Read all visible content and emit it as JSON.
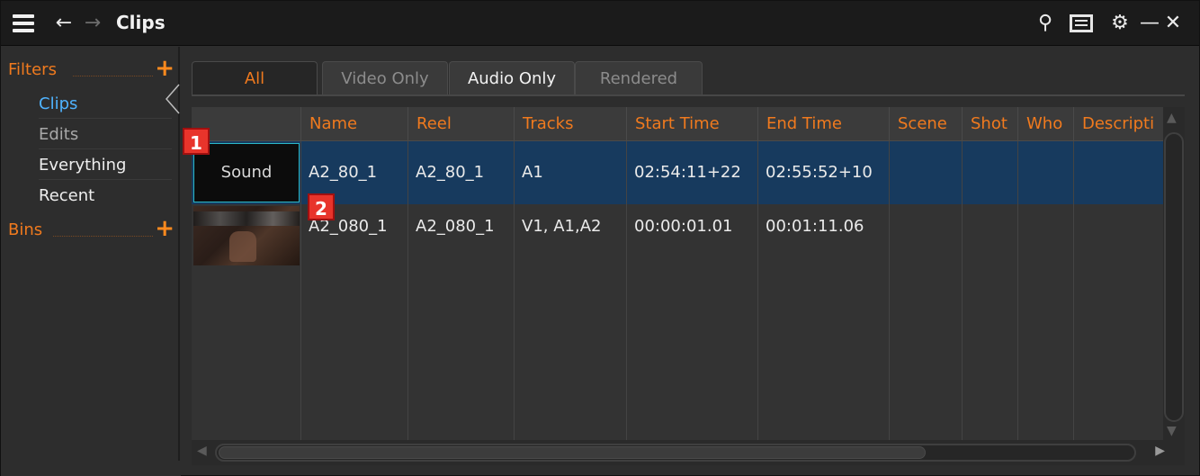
{
  "window": {
    "title": "Clips"
  },
  "sidebar": {
    "filters_label": "Filters",
    "bins_label": "Bins",
    "items": [
      {
        "label": "Clips",
        "state": "selected"
      },
      {
        "label": "Edits",
        "state": "muted"
      },
      {
        "label": "Everything",
        "state": "normal"
      },
      {
        "label": "Recent",
        "state": "normal"
      }
    ]
  },
  "tabs": [
    {
      "label": "All",
      "state": "active"
    },
    {
      "label": "Video Only",
      "state": "disabled"
    },
    {
      "label": "Audio Only",
      "state": "normal"
    },
    {
      "label": "Rendered",
      "state": "disabled"
    }
  ],
  "table": {
    "columns": [
      "",
      "Name",
      "Reel",
      "Tracks",
      "Start Time",
      "End Time",
      "Scene",
      "Shot",
      "Who",
      "Descripti"
    ],
    "rows": [
      {
        "thumbnail": "Sound",
        "name": "A2_80_1",
        "reel": "A2_80_1",
        "tracks": "A1",
        "start": "02:54:11+22",
        "end": "02:55:52+10",
        "selected": true
      },
      {
        "thumbnail": "",
        "name": "A2_080_1",
        "reel": "A2_080_1",
        "tracks": "V1, A1,A2",
        "start": "00:00:01.01",
        "end": "00:01:11.06",
        "selected": false
      }
    ]
  },
  "markers": [
    "1",
    "2"
  ],
  "colors": {
    "accent": "#f07a1e",
    "selection": "#173a5e",
    "link": "#4fb3ff",
    "marker": "#e8342b"
  }
}
